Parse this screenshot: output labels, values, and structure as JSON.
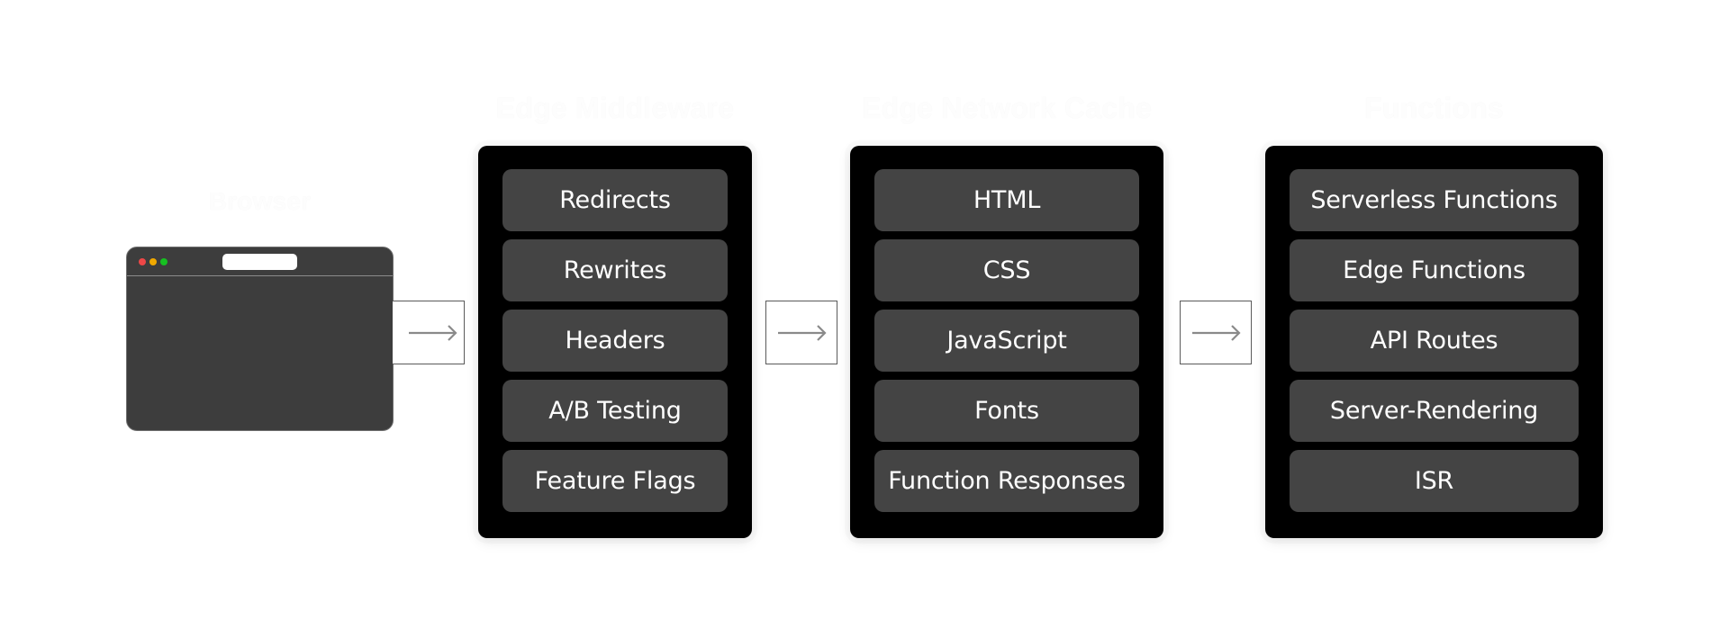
{
  "diagram": {
    "stages": [
      {
        "id": "browser",
        "title": "Browser"
      },
      {
        "id": "edge-middleware",
        "title": "Edge Middleware",
        "items": [
          "Redirects",
          "Rewrites",
          "Headers",
          "A/B Testing",
          "Feature Flags"
        ]
      },
      {
        "id": "edge-network-cache",
        "title": "Edge Network Cache",
        "items": [
          "HTML",
          "CSS",
          "JavaScript",
          "Fonts",
          "Function Responses"
        ]
      },
      {
        "id": "functions",
        "title": "Functions",
        "items": [
          "Serverless Functions",
          "Edge Functions",
          "API Routes",
          "Server-Rendering",
          "ISR"
        ]
      }
    ],
    "connectors": [
      {
        "from": "browser",
        "to": "edge-middleware",
        "icon": "arrow-right-icon"
      },
      {
        "from": "edge-middleware",
        "to": "edge-network-cache",
        "icon": "arrow-right-icon"
      },
      {
        "from": "edge-network-cache",
        "to": "functions",
        "icon": "arrow-right-icon"
      }
    ],
    "browser_window": {
      "traffic_lights": [
        "#ee4747",
        "#f0a800",
        "#16c021"
      ]
    },
    "colors": {
      "panel_bg": "#000000",
      "item_bg": "#444444",
      "item_text": "#ffffff",
      "browser_bg": "#3d3d3d",
      "arrow": "#8a8a8a"
    }
  }
}
